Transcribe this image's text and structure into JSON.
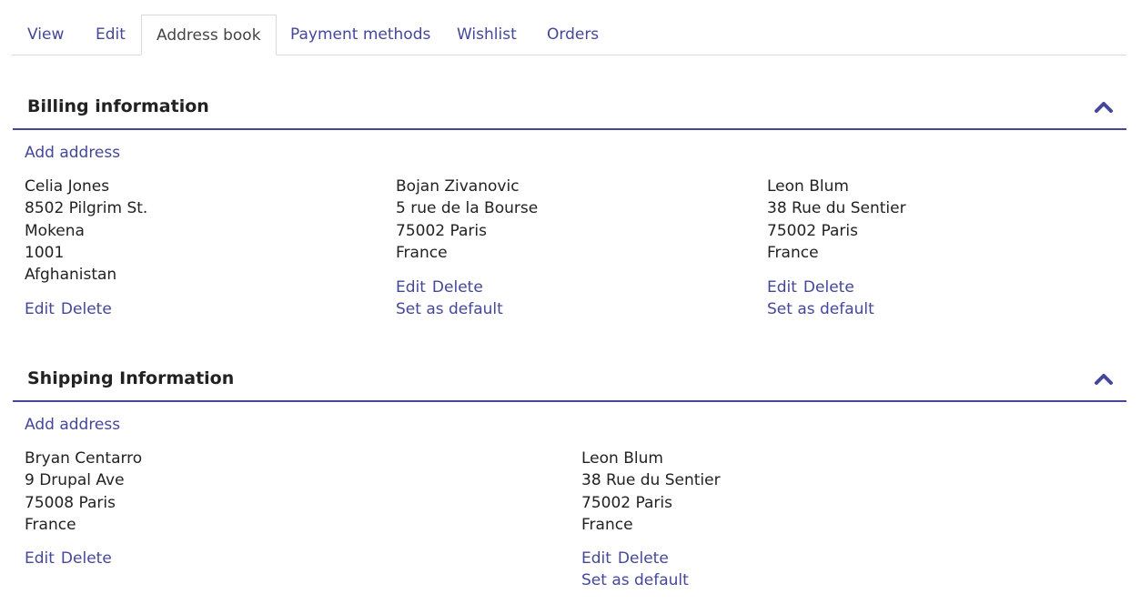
{
  "tabs": [
    {
      "label": "View"
    },
    {
      "label": "Edit"
    },
    {
      "label": "Address book"
    },
    {
      "label": "Payment methods"
    },
    {
      "label": "Wishlist"
    },
    {
      "label": "Orders"
    }
  ],
  "active_tab": "Address book",
  "accent_color": "#44479a",
  "billing": {
    "title": "Billing information",
    "add_label": "Add address",
    "addresses": [
      {
        "lines": [
          "Celia Jones",
          "8502 Pilgrim St.",
          "Mokena",
          "1001",
          "Afghanistan"
        ],
        "edit": "Edit",
        "delete": "Delete"
      },
      {
        "lines": [
          "Bojan Zivanovic",
          "5 rue de la Bourse",
          "75002 Paris",
          "France"
        ],
        "edit": "Edit",
        "delete": "Delete",
        "set_default": "Set as default"
      },
      {
        "lines": [
          "Leon Blum",
          "38 Rue du Sentier",
          "75002 Paris",
          "France"
        ],
        "edit": "Edit",
        "delete": "Delete",
        "set_default": "Set as default"
      }
    ]
  },
  "shipping": {
    "title": "Shipping Information",
    "add_label": "Add address",
    "addresses": [
      {
        "lines": [
          "Bryan Centarro",
          "9 Drupal Ave",
          "75008 Paris",
          "France"
        ],
        "edit": "Edit",
        "delete": "Delete"
      },
      {
        "lines": [
          "Leon Blum",
          "38 Rue du Sentier",
          "75002 Paris",
          "France"
        ],
        "edit": "Edit",
        "delete": "Delete",
        "set_default": "Set as default"
      }
    ]
  }
}
